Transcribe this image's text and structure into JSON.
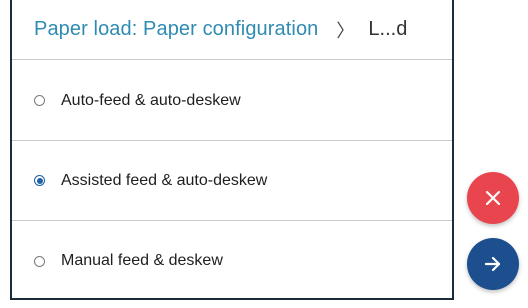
{
  "header": {
    "current": "Paper load: Paper configuration",
    "separator": "〉",
    "next": "L...d"
  },
  "options": [
    {
      "label": "Auto-feed & auto-deskew",
      "selected": false
    },
    {
      "label": "Assisted feed & auto-deskew",
      "selected": true
    },
    {
      "label": "Manual feed & deskew",
      "selected": false
    }
  ],
  "actions": {
    "cancel_icon": "close-icon",
    "next_icon": "arrow-right-icon"
  },
  "colors": {
    "accent": "#2f8bb2",
    "radio_selected": "#1f5fa8",
    "cancel": "#e8454f",
    "next": "#1d4f8f"
  }
}
